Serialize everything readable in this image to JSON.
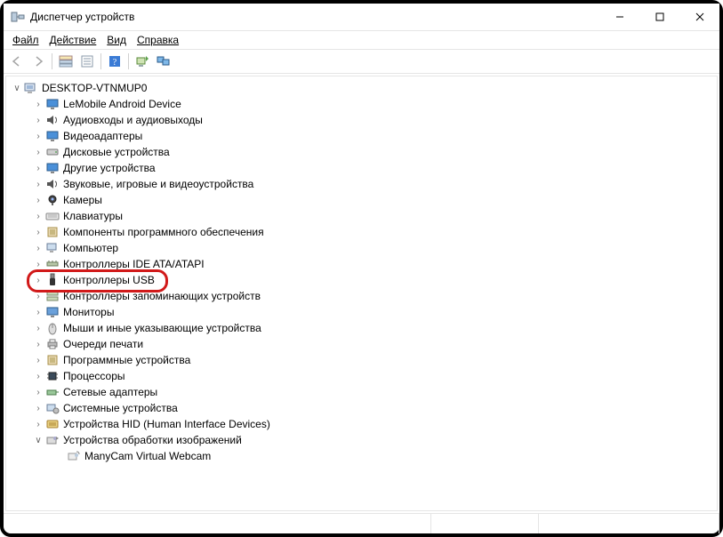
{
  "window": {
    "title": "Диспетчер устройств"
  },
  "sysbtns": {
    "min": "minimize",
    "max": "maximize",
    "close": "close"
  },
  "menu": {
    "file": "Файл",
    "action": "Действие",
    "view": "Вид",
    "help": "Справка"
  },
  "toolbar": {
    "back": "Назад",
    "forward": "Вперед",
    "show_hidden": "Показать скрытые",
    "help": "Справка",
    "scan": "Обновить",
    "monitors": "Мониторы"
  },
  "tree": {
    "root": "DESKTOP-VTNMUP0",
    "nodes": [
      {
        "label": "LeMobile Android Device",
        "icon": "display"
      },
      {
        "label": "Аудиовходы и аудиовыходы",
        "icon": "speaker"
      },
      {
        "label": "Видеоадаптеры",
        "icon": "display"
      },
      {
        "label": "Дисковые устройства",
        "icon": "drive"
      },
      {
        "label": "Другие устройства",
        "icon": "display"
      },
      {
        "label": "Звуковые, игровые и видеоустройства",
        "icon": "speaker"
      },
      {
        "label": "Камеры",
        "icon": "camera"
      },
      {
        "label": "Клавиатуры",
        "icon": "keyboard"
      },
      {
        "label": "Компоненты программного обеспечения",
        "icon": "component"
      },
      {
        "label": "Компьютер",
        "icon": "computer"
      },
      {
        "label": "Контроллеры IDE ATA/ATAPI",
        "icon": "controller"
      },
      {
        "label": "Контроллеры USB",
        "icon": "usb",
        "highlight": true
      },
      {
        "label": "Контроллеры запоминающих устройств",
        "icon": "storage"
      },
      {
        "label": "Мониторы",
        "icon": "monitor"
      },
      {
        "label": "Мыши и иные указывающие устройства",
        "icon": "mouse"
      },
      {
        "label": "Очереди печати",
        "icon": "printer"
      },
      {
        "label": "Программные устройства",
        "icon": "component"
      },
      {
        "label": "Процессоры",
        "icon": "cpu"
      },
      {
        "label": "Сетевые адаптеры",
        "icon": "network"
      },
      {
        "label": "Системные устройства",
        "icon": "system"
      },
      {
        "label": "Устройства HID (Human Interface Devices)",
        "icon": "hid"
      },
      {
        "label": "Устройства обработки изображений",
        "icon": "imaging",
        "expanded": true,
        "children": [
          {
            "label": "ManyCam Virtual Webcam",
            "icon": "imaging-leaf"
          }
        ]
      }
    ]
  },
  "colors": {
    "highlight": "#d11a1a"
  }
}
